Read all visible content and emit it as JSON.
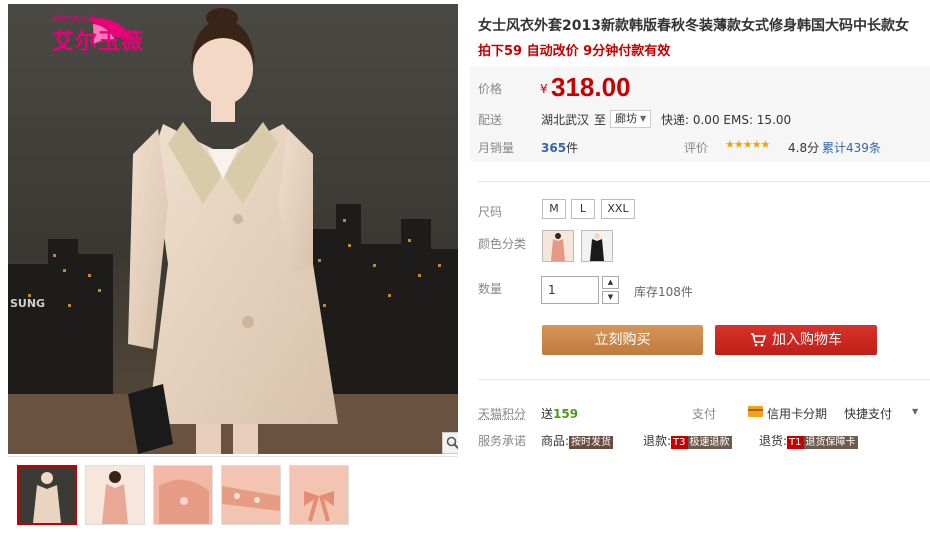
{
  "brand": {
    "name": "艾尔玉薇",
    "sub": "aieryuwei"
  },
  "product": {
    "title": "女士风衣外套2013新款韩版春秋冬装薄款女式修身韩国大码中长款女",
    "promo": "拍下59 自动改价 9分钟付款有效"
  },
  "price": {
    "label": "价格",
    "currency": "¥",
    "value": "318.00"
  },
  "shipping": {
    "label": "配送",
    "from": "湖北武汉",
    "to_label": "至",
    "to": "廊坊",
    "fees": "快递: 0.00 EMS: 15.00"
  },
  "sales": {
    "label": "月销量",
    "count": "365",
    "unit": "件"
  },
  "rating": {
    "label": "评价",
    "stars": "★★★★★",
    "score": "4.8分",
    "reviews": "累计439条",
    "value": 4.8
  },
  "size": {
    "label": "尺码",
    "options": [
      "M",
      "L",
      "XXL"
    ]
  },
  "color": {
    "label": "颜色分类"
  },
  "quantity": {
    "label": "数量",
    "value": "1",
    "stock": "库存108件"
  },
  "buttons": {
    "buy": "立刻购买",
    "cart": "加入购物车"
  },
  "points": {
    "label": "天猫积分",
    "prefix": "送",
    "value": "159"
  },
  "payment": {
    "label": "支付",
    "credit": "信用卡分期",
    "quick": "快捷支付"
  },
  "service": {
    "label": "服务承诺",
    "goods_label": "商品:",
    "goods_tag": "按时发货",
    "refund_label": "退款:",
    "refund_badge": "T3",
    "refund_tag": "极速退款",
    "return_label": "退货:",
    "return_badge": "T1",
    "return_tag": "退货保障卡"
  },
  "colors": {
    "price_red": "#c40000",
    "buy_btn": "#c9884a",
    "cart_btn": "#c8231d",
    "coat": "#e8d4c0",
    "thumb_bg": "#f3c9bb"
  }
}
